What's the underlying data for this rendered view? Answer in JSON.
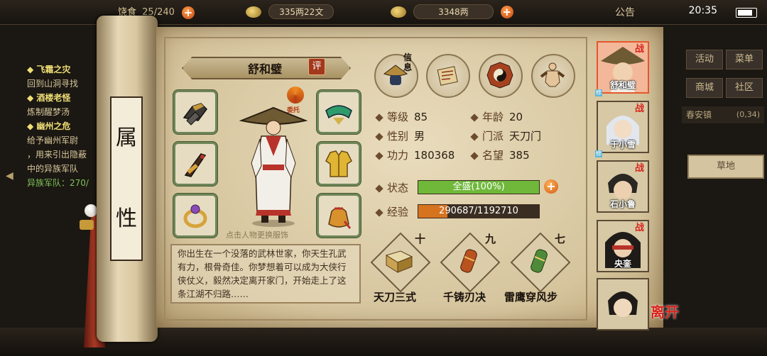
{
  "topbar": {
    "food_label": "饶食",
    "food_value": "25/240",
    "copper_value": "335两22文",
    "silver_value": "3348两",
    "notice": "公告",
    "time": "20:35"
  },
  "quests": [
    {
      "title": "◆ 飞霜之灾",
      "lines": [
        "回到山洞寻找"
      ]
    },
    {
      "title": "◆ 酒楼老怪",
      "lines": [
        "炼制醒梦汤"
      ]
    },
    {
      "title": "◆ 幽州之危",
      "lines": [
        "给予幽州军尉",
        "，用来引出隐蔽",
        "中的异族军队",
        "异族军队：270/"
      ]
    }
  ],
  "right_menu": {
    "buttons": [
      "活动",
      "菜单",
      "商城",
      "社区"
    ],
    "location": "春安镇",
    "coords": "(0,34)",
    "terrain": "草地"
  },
  "scroll": {
    "label_chars": [
      "属",
      "性"
    ]
  },
  "character": {
    "name": "舒和璧",
    "rate_label": "评",
    "swap_label": "委托",
    "change_hint": "点击人物更换服饰",
    "stats": {
      "level_label": "等级",
      "level": "85",
      "age_label": "年龄",
      "age": "20",
      "gender_label": "性别",
      "gender": "男",
      "sect_label": "门派",
      "sect": "天刀门",
      "power_label": "功力",
      "power": "180368",
      "fame_label": "名望",
      "fame": "385"
    },
    "status_label": "状态",
    "status_text": "全盛(100%)",
    "status_fraction": 1.0,
    "exp_label": "经验",
    "exp_text": "290687/1192710",
    "exp_fraction": 0.2437,
    "bio": "你出生在一个没落的武林世家，你天生孔武有力，根骨奇佳。你梦想着可以成为大侠行侠仗义，毅然决定离开家门，开始走上了这条江湖不归路……"
  },
  "tabs": {
    "info_label": "信息"
  },
  "skills": [
    {
      "name": "天刀三式",
      "level": "十"
    },
    {
      "name": "千铸刃决",
      "level": "九"
    },
    {
      "name": "雷鹰穿风步",
      "level": "七"
    }
  ],
  "party": [
    {
      "name": "舒和璧",
      "tag": "战",
      "active": true
    },
    {
      "name": "于小雪",
      "tag": "战",
      "active": false
    },
    {
      "name": "石小鲁",
      "tag": "战",
      "active": false
    },
    {
      "name": "央銮",
      "tag": "战",
      "active": false
    },
    {
      "name": "",
      "tag": "",
      "active": false
    }
  ],
  "leave_label": "离开",
  "colors": {
    "status_bar": "#6fb83a",
    "exp_bar": "#d6731f",
    "accent_red": "#d8251c"
  }
}
